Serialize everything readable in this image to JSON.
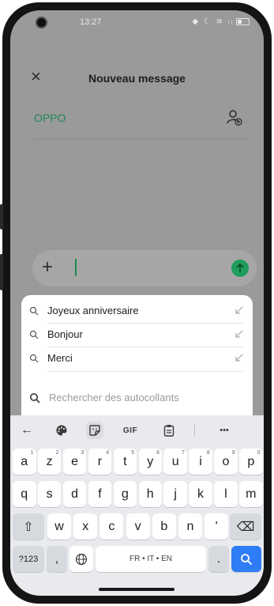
{
  "status_bar": {
    "time": "13:27",
    "icons": "◆ ☾ ≋ ᵢₗ"
  },
  "header": {
    "close_label": "×",
    "title": "Nouveau message"
  },
  "recipient": {
    "name": "OPPO"
  },
  "compose": {
    "plus_label": "+"
  },
  "suggestions": {
    "items": [
      {
        "label": "Joyeux anniversaire"
      },
      {
        "label": "Bonjour"
      },
      {
        "label": "Merci"
      }
    ],
    "sticker_search_placeholder": "Rechercher des autocollants"
  },
  "keyboard": {
    "toolbar": {
      "back": "←",
      "gif": "GIF",
      "more": "•••"
    },
    "row1": [
      {
        "key": "a",
        "hint": "1"
      },
      {
        "key": "z",
        "hint": "2"
      },
      {
        "key": "e",
        "hint": "3"
      },
      {
        "key": "r",
        "hint": "4"
      },
      {
        "key": "t",
        "hint": "5"
      },
      {
        "key": "y",
        "hint": "6"
      },
      {
        "key": "u",
        "hint": "7"
      },
      {
        "key": "i",
        "hint": "8"
      },
      {
        "key": "o",
        "hint": "9"
      },
      {
        "key": "p",
        "hint": "0"
      }
    ],
    "row2": [
      "q",
      "s",
      "d",
      "f",
      "g",
      "h",
      "j",
      "k",
      "l",
      "m"
    ],
    "row3": [
      "w",
      "x",
      "c",
      "v",
      "b",
      "n",
      "'"
    ],
    "shift": "⇧",
    "backspace": "⌫",
    "symbols": "?123",
    "comma": ",",
    "space": "FR • IT • EN",
    "period": ".",
    "accent_color": "#2f7df6"
  }
}
